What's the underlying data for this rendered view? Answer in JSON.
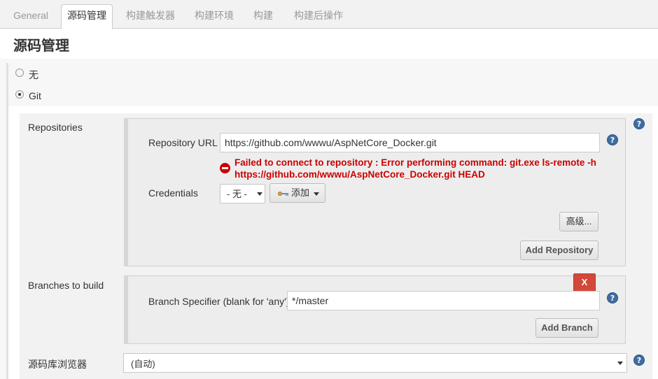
{
  "tabs": [
    {
      "label": "General",
      "active": false
    },
    {
      "label": "源码管理",
      "active": true
    },
    {
      "label": "构建触发器",
      "active": false
    },
    {
      "label": "构建环境",
      "active": false
    },
    {
      "label": "构建",
      "active": false
    },
    {
      "label": "构建后操作",
      "active": false
    }
  ],
  "section_title": "源码管理",
  "scm_options": [
    {
      "label": "无",
      "selected": false
    },
    {
      "label": "Git",
      "selected": true
    }
  ],
  "repositories": {
    "label": "Repositories",
    "url_label": "Repository URL",
    "url_value": "https://github.com/wwwu/AspNetCore_Docker.git",
    "error_line1": "Failed to connect to repository : Error performing command: git.exe ls-remote -h",
    "error_line2": "https://github.com/wwwu/AspNetCore_Docker.git HEAD",
    "credentials_label": "Credentials",
    "credentials_value": "- 无 -",
    "add_credentials_label": "添加",
    "advanced_label": "高级...",
    "add_repository_label": "Add Repository"
  },
  "branches": {
    "label": "Branches to build",
    "specifier_label": "Branch Specifier (blank for 'any')",
    "specifier_value": "*/master",
    "delete_label": "X",
    "add_branch_label": "Add Branch"
  },
  "repo_browser": {
    "label": "源码库浏览器",
    "value": "(自动)"
  },
  "help_glyph": "?",
  "icons": [
    "help-icon",
    "error-icon",
    "key-icon",
    "chevron-down-icon"
  ],
  "colors": {
    "error": "#cc0000",
    "help": "#3f6da0",
    "delete": "#d24939"
  }
}
